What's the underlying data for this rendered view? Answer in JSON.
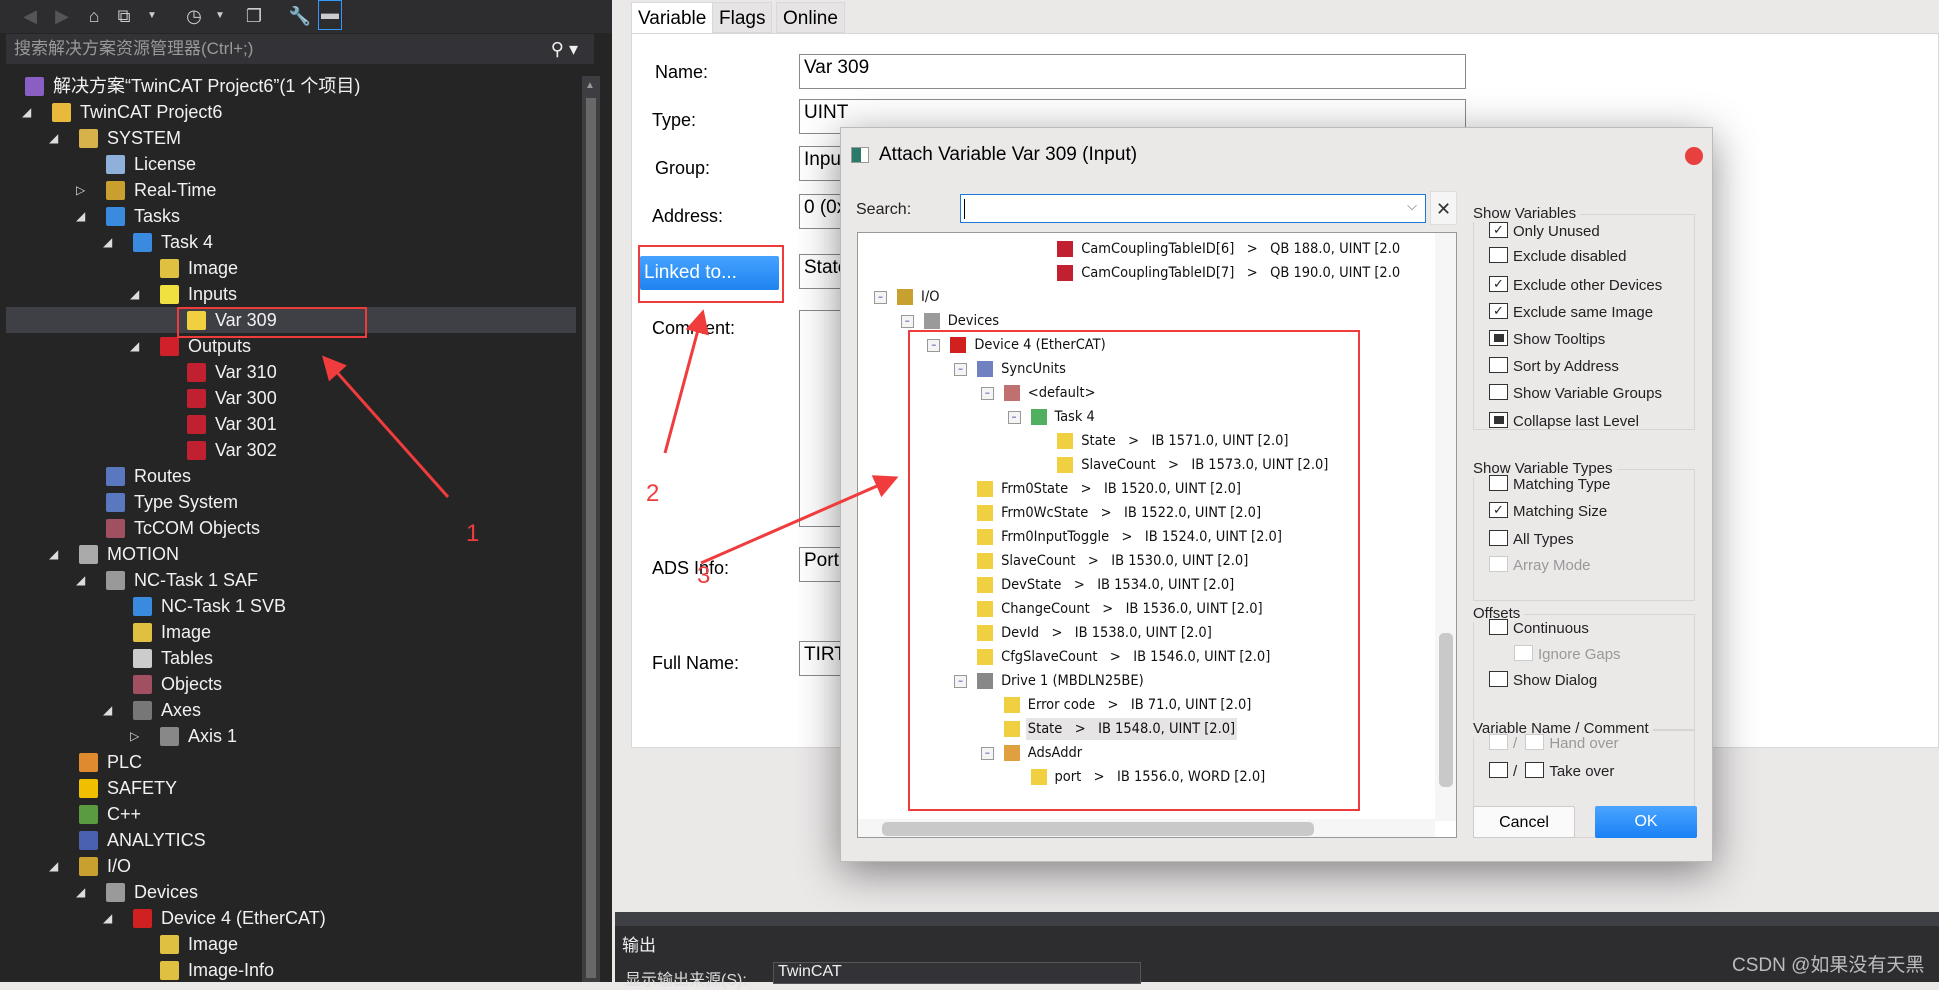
{
  "solution_explorer": {
    "search_placeholder": "搜索解决方案资源管理器(Ctrl+;)",
    "items": [
      {
        "label": "解决方案“TwinCAT Project6”(1 个项目)",
        "level": 0,
        "toggle": "none",
        "icon": "solution-icon"
      },
      {
        "label": "TwinCAT Project6",
        "level": 1,
        "toggle": "expanded",
        "icon": "project-icon"
      },
      {
        "label": "SYSTEM",
        "level": 2,
        "toggle": "expanded",
        "icon": "system-icon"
      },
      {
        "label": "License",
        "level": 3,
        "toggle": "none",
        "icon": "license-icon"
      },
      {
        "label": "Real-Time",
        "level": 3,
        "toggle": "collapsed",
        "icon": "realtime-icon"
      },
      {
        "label": "Tasks",
        "level": 3,
        "toggle": "expanded",
        "icon": "tasks-icon"
      },
      {
        "label": "Task 4",
        "level": 4,
        "toggle": "expanded",
        "icon": "task-icon"
      },
      {
        "label": "Image",
        "level": 5,
        "toggle": "none",
        "icon": "image-icon"
      },
      {
        "label": "Inputs",
        "level": 5,
        "toggle": "expanded",
        "icon": "inputs-icon"
      },
      {
        "label": "Var 309",
        "level": 6,
        "toggle": "none",
        "icon": "input-var-icon",
        "selected": true
      },
      {
        "label": "Outputs",
        "level": 5,
        "toggle": "expanded",
        "icon": "outputs-icon"
      },
      {
        "label": "Var 310",
        "level": 6,
        "toggle": "none",
        "icon": "output-var-icon"
      },
      {
        "label": "Var 300",
        "level": 6,
        "toggle": "none",
        "icon": "output-var-icon"
      },
      {
        "label": "Var 301",
        "level": 6,
        "toggle": "none",
        "icon": "output-var-icon"
      },
      {
        "label": "Var 302",
        "level": 6,
        "toggle": "none",
        "icon": "output-var-icon"
      },
      {
        "label": "Routes",
        "level": 3,
        "toggle": "none",
        "icon": "routes-icon"
      },
      {
        "label": "Type System",
        "level": 3,
        "toggle": "none",
        "icon": "type-system-icon"
      },
      {
        "label": "TcCOM Objects",
        "level": 3,
        "toggle": "none",
        "icon": "tccom-icon"
      },
      {
        "label": "MOTION",
        "level": 2,
        "toggle": "expanded",
        "icon": "motion-icon"
      },
      {
        "label": "NC-Task 1 SAF",
        "level": 3,
        "toggle": "expanded",
        "icon": "nc-task-icon"
      },
      {
        "label": "NC-Task 1 SVB",
        "level": 4,
        "toggle": "none",
        "icon": "task-icon"
      },
      {
        "label": "Image",
        "level": 4,
        "toggle": "none",
        "icon": "image-icon"
      },
      {
        "label": "Tables",
        "level": 4,
        "toggle": "none",
        "icon": "tables-icon"
      },
      {
        "label": "Objects",
        "level": 4,
        "toggle": "none",
        "icon": "tccom-icon"
      },
      {
        "label": "Axes",
        "level": 4,
        "toggle": "expanded",
        "icon": "axes-icon"
      },
      {
        "label": "Axis 1",
        "level": 5,
        "toggle": "collapsed",
        "icon": "axis-icon"
      },
      {
        "label": "PLC",
        "level": 2,
        "toggle": "none",
        "icon": "plc-icon"
      },
      {
        "label": "SAFETY",
        "level": 2,
        "toggle": "none",
        "icon": "safety-icon"
      },
      {
        "label": "C++",
        "level": 2,
        "toggle": "none",
        "icon": "cpp-icon"
      },
      {
        "label": "ANALYTICS",
        "level": 2,
        "toggle": "none",
        "icon": "analytics-icon"
      },
      {
        "label": "I/O",
        "level": 2,
        "toggle": "expanded",
        "icon": "io-icon"
      },
      {
        "label": "Devices",
        "level": 3,
        "toggle": "expanded",
        "icon": "devices-icon"
      },
      {
        "label": "Device 4 (EtherCAT)",
        "level": 4,
        "toggle": "expanded",
        "icon": "ethercat-icon"
      },
      {
        "label": "Image",
        "level": 5,
        "toggle": "none",
        "icon": "image-icon"
      },
      {
        "label": "Image-Info",
        "level": 5,
        "toggle": "none",
        "icon": "image-icon"
      }
    ]
  },
  "editor": {
    "tabs": [
      {
        "label": "Variable",
        "active": true
      },
      {
        "label": "Flags"
      },
      {
        "label": "Online"
      }
    ],
    "fields": {
      "name_label": "Name:",
      "name_value": "Var 309",
      "type_label": "Type:",
      "type_value": "UINT",
      "group_label": "Group:",
      "group_value": "Inpu",
      "address_label": "Address:",
      "address_value": "0 (0x",
      "linked_button": "Linked to...",
      "linked_value": "State",
      "comment_label": "Comment:",
      "ads_label": "ADS Info:",
      "ads_value": "Port",
      "fullname_label": "Full Name:",
      "fullname_value": "TIRT"
    }
  },
  "output": {
    "title": "输出",
    "source_label": "显示输出来源(S):",
    "source_value": "TwinCAT"
  },
  "dialog": {
    "title": "Attach Variable Var 309 (Input)",
    "search_label": "Search:",
    "search_value": "",
    "tree": [
      {
        "label": "CamCouplingTableID[6]   >   QB 188.0, UINT [2.0",
        "level": 6,
        "toggle": "none",
        "icon": "output-var-icon"
      },
      {
        "label": "CamCouplingTableID[7]   >   QB 190.0, UINT [2.0",
        "level": 6,
        "toggle": "none",
        "icon": "output-var-icon"
      },
      {
        "label": "I/O",
        "level": 0,
        "toggle": "expanded",
        "icon": "io-icon"
      },
      {
        "label": "Devices",
        "level": 1,
        "toggle": "expanded",
        "icon": "devices-icon"
      },
      {
        "label": "Device 4 (EtherCAT)",
        "level": 2,
        "toggle": "expanded",
        "icon": "ethercat-icon"
      },
      {
        "label": "SyncUnits",
        "level": 3,
        "toggle": "expanded",
        "icon": "syncunits-icon"
      },
      {
        "label": "<default>",
        "level": 4,
        "toggle": "expanded",
        "icon": "syncunit-default-icon"
      },
      {
        "label": "Task 4",
        "level": 5,
        "toggle": "expanded",
        "icon": "syncunit-task-icon"
      },
      {
        "label": "State   >   IB 1571.0, UINT [2.0]",
        "level": 6,
        "toggle": "none",
        "icon": "input-var-icon"
      },
      {
        "label": "SlaveCount   >   IB 1573.0, UINT [2.0]",
        "level": 6,
        "toggle": "none",
        "icon": "input-var-icon"
      },
      {
        "label": "Frm0State   >   IB 1520.0, UINT [2.0]",
        "level": 3,
        "toggle": "none",
        "icon": "input-var-icon"
      },
      {
        "label": "Frm0WcState   >   IB 1522.0, UINT [2.0]",
        "level": 3,
        "toggle": "none",
        "icon": "input-var-icon"
      },
      {
        "label": "Frm0InputToggle   >   IB 1524.0, UINT [2.0]",
        "level": 3,
        "toggle": "none",
        "icon": "input-var-icon"
      },
      {
        "label": "SlaveCount   >   IB 1530.0, UINT [2.0]",
        "level": 3,
        "toggle": "none",
        "icon": "input-var-icon"
      },
      {
        "label": "DevState   >   IB 1534.0, UINT [2.0]",
        "level": 3,
        "toggle": "none",
        "icon": "input-var-icon"
      },
      {
        "label": "ChangeCount   >   IB 1536.0, UINT [2.0]",
        "level": 3,
        "toggle": "none",
        "icon": "input-var-icon"
      },
      {
        "label": "DevId   >   IB 1538.0, UINT [2.0]",
        "level": 3,
        "toggle": "none",
        "icon": "input-var-icon"
      },
      {
        "label": "CfgSlaveCount   >   IB 1546.0, UINT [2.0]",
        "level": 3,
        "toggle": "none",
        "icon": "input-var-icon"
      },
      {
        "label": "Drive 1 (MBDLN25BE)",
        "level": 3,
        "toggle": "expanded",
        "icon": "drive-icon"
      },
      {
        "label": "Error code   >   IB 71.0, UINT [2.0]",
        "level": 4,
        "toggle": "none",
        "icon": "input-var-icon"
      },
      {
        "label": "State   >   IB 1548.0, UINT [2.0]",
        "level": 4,
        "toggle": "none",
        "icon": "input-var-linked-icon",
        "highlighted": true
      },
      {
        "label": "AdsAddr",
        "level": 4,
        "toggle": "expanded",
        "icon": "adsaddr-icon"
      },
      {
        "label": "port   >   IB 1556.0, WORD [2.0]",
        "level": 5,
        "toggle": "none",
        "icon": "input-var-icon"
      }
    ],
    "groups": [
      {
        "title": "Show Variables",
        "options": [
          {
            "label": "Only Unused",
            "state": "checked"
          },
          {
            "label": "Exclude disabled",
            "state": "unchecked"
          },
          {
            "label": "Exclude other Devices",
            "state": "checked"
          },
          {
            "label": "Exclude same Image",
            "state": "checked"
          },
          {
            "label": "Show Tooltips",
            "state": "indeterminate"
          },
          {
            "label": "Sort by Address",
            "state": "unchecked"
          },
          {
            "label": "Show Variable Groups",
            "state": "unchecked"
          },
          {
            "label": "Collapse last Level",
            "state": "indeterminate"
          }
        ]
      },
      {
        "title": "Show Variable Types",
        "options": [
          {
            "label": "Matching Type",
            "state": "unchecked"
          },
          {
            "label": "Matching Size",
            "state": "checked"
          },
          {
            "label": "All Types",
            "state": "unchecked"
          },
          {
            "label": "Array Mode",
            "state": "unchecked",
            "disabled": true
          }
        ]
      },
      {
        "title": "Offsets",
        "options": [
          {
            "label": "Continuous",
            "state": "unchecked"
          },
          {
            "label": "Ignore Gaps",
            "state": "unchecked",
            "disabled": true,
            "indent": true
          },
          {
            "label": "Show Dialog",
            "state": "unchecked"
          }
        ]
      },
      {
        "title": "Variable Name / Comment",
        "options": [
          {
            "label": "Hand over",
            "state": "unchecked",
            "disabled": true,
            "double": true
          },
          {
            "label": "Take over",
            "state": "unchecked",
            "double": true
          }
        ]
      }
    ],
    "cancel": "Cancel",
    "ok": "OK"
  },
  "annotations": {
    "step1": "1",
    "step2": "2",
    "step3": "3",
    "color": "#f03c3c"
  },
  "watermark": "CSDN @如果没有天黑",
  "colors": {
    "accent": "#1f84f0",
    "selection": "#3f3f46",
    "dark_bg": "#252526"
  }
}
